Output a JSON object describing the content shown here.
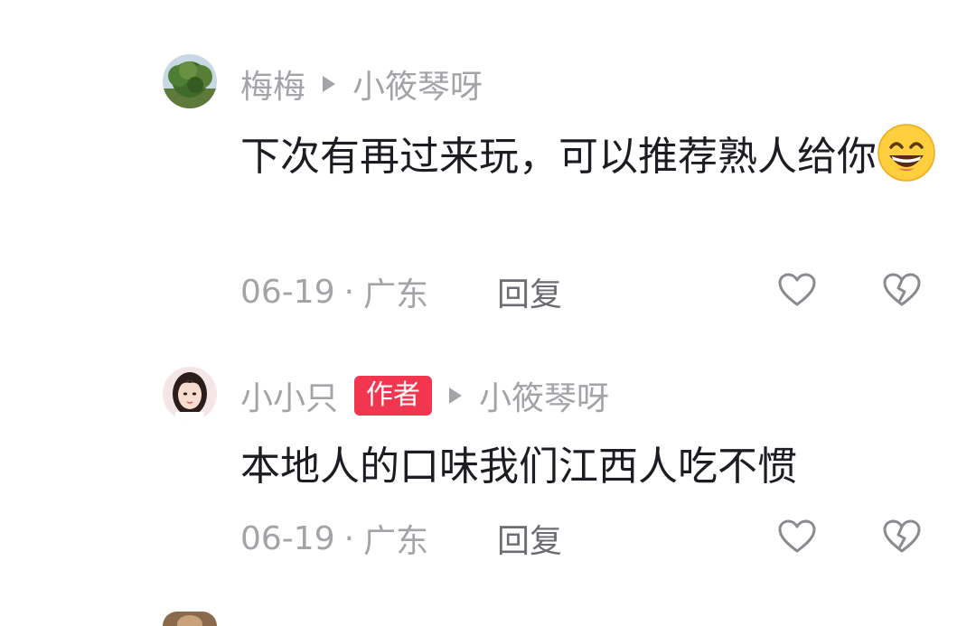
{
  "comments": [
    {
      "author": "梅梅",
      "is_author": false,
      "reply_to": "小筱琴呀",
      "text": "下次有再过来玩，可以推荐熟人给你",
      "emoji": "grinning-emoji",
      "date": "06-19",
      "separator": "·",
      "location": "广东",
      "reply_label": "回复",
      "avatar": "tree-avatar"
    },
    {
      "author": "小小只",
      "is_author": true,
      "badge": "作者",
      "reply_to": "小筱琴呀",
      "text": "本地人的口味我们江西人吃不惯",
      "date": "06-19",
      "separator": "·",
      "location": "广东",
      "reply_label": "回复",
      "avatar": "girl-portrait-avatar"
    }
  ],
  "icons": {
    "reply_arrow": "play-arrow-icon",
    "like": "heart-outline-icon",
    "dislike": "broken-heart-icon"
  },
  "colors": {
    "muted_text": "#a3a3a8",
    "body_text": "#1c1c22",
    "reply_text": "#6c6c72",
    "author_badge": "#f3364f"
  }
}
